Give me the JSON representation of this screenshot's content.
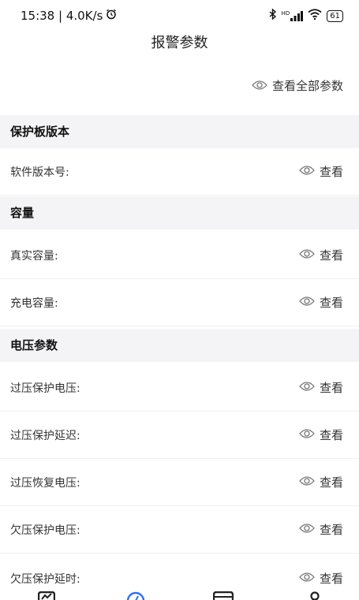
{
  "status": {
    "time_speed": "15:38 | 4.0K/s",
    "alarm_icon": "alarm-clock-icon",
    "bluetooth_icon": "bluetooth-icon",
    "signal_label": "HD",
    "battery": "61"
  },
  "header": {
    "title": "报警参数"
  },
  "view_all": {
    "label": "查看全部参数",
    "icon": "eye-icon"
  },
  "sections": [
    {
      "title": "保护板版本",
      "rows": [
        {
          "label": "软件版本号:",
          "action": "查看"
        }
      ]
    },
    {
      "title": "容量",
      "rows": [
        {
          "label": "真实容量:",
          "action": "查看"
        },
        {
          "label": "充电容量:",
          "action": "查看"
        }
      ]
    },
    {
      "title": "电压参数",
      "rows": [
        {
          "label": "过压保护电压:",
          "action": "查看"
        },
        {
          "label": "过压保护延迟:",
          "action": "查看"
        },
        {
          "label": "过压恢复电压:",
          "action": "查看"
        },
        {
          "label": "欠压保护电压:",
          "action": "查看"
        },
        {
          "label": "欠压保护延时:",
          "action": "查看"
        }
      ]
    }
  ],
  "bottom_nav": {
    "accent": "#2f6fed",
    "items": [
      "chart-icon",
      "gauge-icon",
      "card-icon",
      "user-icon"
    ]
  }
}
